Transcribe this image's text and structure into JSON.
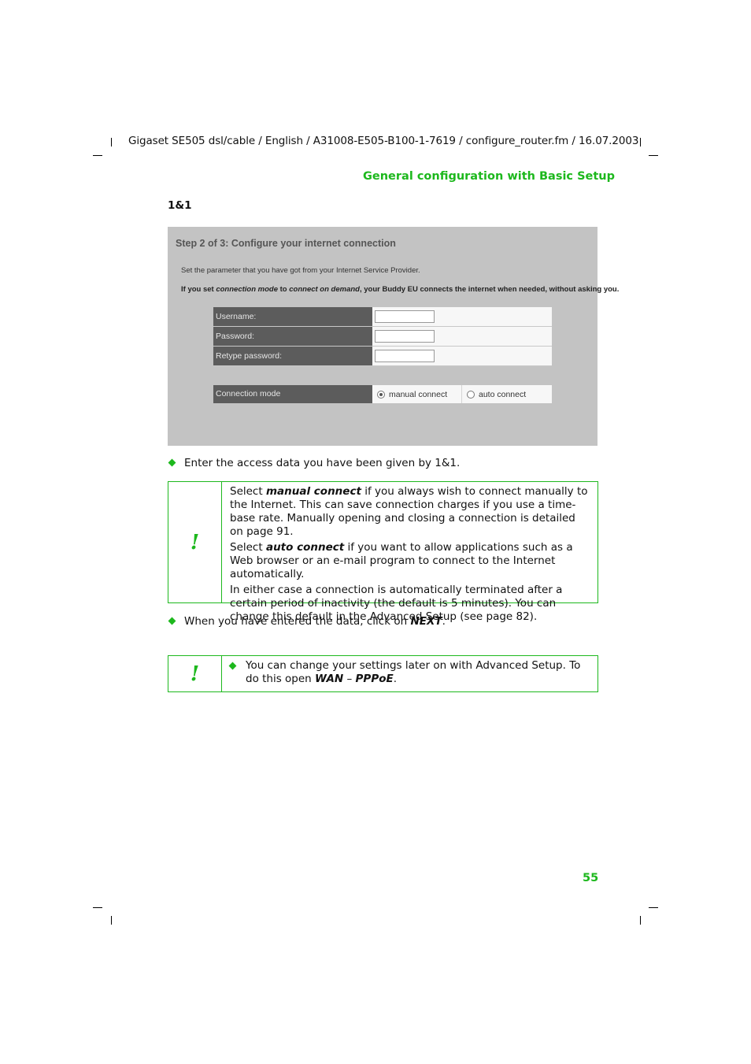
{
  "header": {
    "running_header": "Gigaset SE505 dsl/cable / English / A31008-E505-B100-1-7619 / configure_router.fm / 16.07.2003",
    "section_title": "General configuration with Basic Setup"
  },
  "sub_heading": "1&1",
  "screenshot": {
    "title": "Step 2 of 3: Configure your internet connection",
    "instruction": "Set the parameter that you have got from your Internet Service Provider.",
    "note_prefix": "If you set ",
    "note_em1": "connection mode",
    "note_mid": " to ",
    "note_em2": "connect on demand",
    "note_suffix": ", your Buddy EU connects the internet when needed, without asking you.",
    "fields": [
      {
        "label": "Username:",
        "value": ""
      },
      {
        "label": "Password:",
        "value": ""
      },
      {
        "label": "Retype password:",
        "value": ""
      }
    ],
    "connection_mode": {
      "label": "Connection mode",
      "options": [
        {
          "label": "manual connect",
          "selected": true
        },
        {
          "label": "auto connect",
          "selected": false
        }
      ]
    }
  },
  "steps": {
    "step1": "Enter the access data you have been given by 1&1.",
    "step2_prefix": "When you have entered the data, click on ",
    "step2_em": "NEXT",
    "step2_suffix": "."
  },
  "note1": {
    "icon": "exclamation-icon",
    "glyph": "!",
    "p1_prefix": "Select ",
    "p1_em": "manual connect",
    "p1_suffix": " if you always wish to connect manually to the Internet. This can save connection charges if you use a time-base rate. Manually opening and closing a connection is detailed on page 91.",
    "p2_prefix": "Select ",
    "p2_em": "auto connect",
    "p2_suffix": " if you want to allow applications such as a Web browser or an e-mail program to connect to the Internet automatically.",
    "p3": "In either case a connection is automatically terminated after a certain period of inactivity (the default is 5 minutes). You can change this default in the Advanced Setup (see page 82)."
  },
  "note2": {
    "icon": "exclamation-icon",
    "glyph": "!",
    "text_prefix": "You can change your settings later on with Advanced Setup. To do this open ",
    "em1": "WAN",
    "sep": " – ",
    "em2": "PPPoE",
    "suffix": "."
  },
  "page_number": "55",
  "colors": {
    "accent_green": "#1db81d",
    "screenshot_bg": "#c3c3c3",
    "label_bg": "#5c5c5c"
  }
}
